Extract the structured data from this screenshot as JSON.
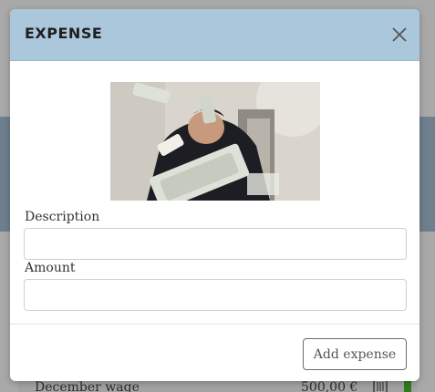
{
  "background": {
    "row": {
      "description": "December wage",
      "amount": "500,00 €",
      "delete_icon": "trash-icon"
    }
  },
  "modal": {
    "title": "EXPENSE",
    "close_icon": "close-icon",
    "gif_alt": "money-throwing-gif",
    "description_label": "Description",
    "description_value": "",
    "amount_label": "Amount",
    "amount_value": "",
    "submit_label": "Add expense"
  },
  "colors": {
    "header": "#abc7dc",
    "overlay": "#a9a9a9",
    "income_bar": "#2f7d1f"
  }
}
